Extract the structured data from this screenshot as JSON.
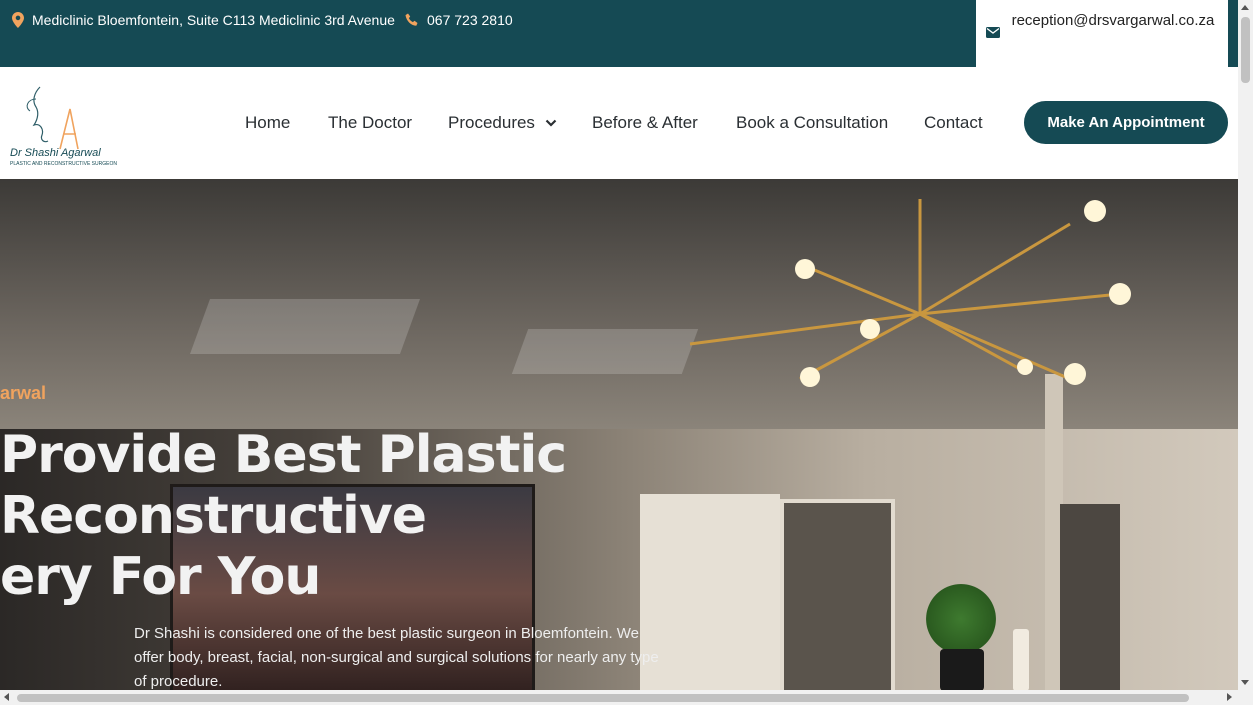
{
  "topbar": {
    "address": "Mediclinic Bloemfontein, Suite C113 Mediclinic 3rd Avenue",
    "phone": "067 723 2810",
    "email": "reception@drsvargarwal.co.za",
    "colors": {
      "bg": "#154a54",
      "icon": "#f0a35e"
    },
    "icons": [
      "map-pin-icon",
      "phone-icon",
      "envelope-icon"
    ]
  },
  "logo": {
    "name_line": "Dr Shashi Agarwal",
    "tagline": "PLASTIC AND RECONSTRUCTIVE SURGEON"
  },
  "nav": {
    "items": [
      {
        "label": "Home"
      },
      {
        "label": "The Doctor"
      },
      {
        "label": "Procedures"
      },
      {
        "label": "Before & After"
      },
      {
        "label": "Book a Consultation"
      },
      {
        "label": "Contact"
      }
    ],
    "cta": "Make An Appointment"
  },
  "hero": {
    "eyebrow": "arwal",
    "title_lines": [
      "Provide Best Plastic",
      "Reconstructive",
      "ery For You"
    ],
    "text": "Dr Shashi is considered one of the best plastic surgeon in Bloemfontein. We offer body, breast, facial, non-surgical and surgical solutions for nearly any type of procedure."
  }
}
